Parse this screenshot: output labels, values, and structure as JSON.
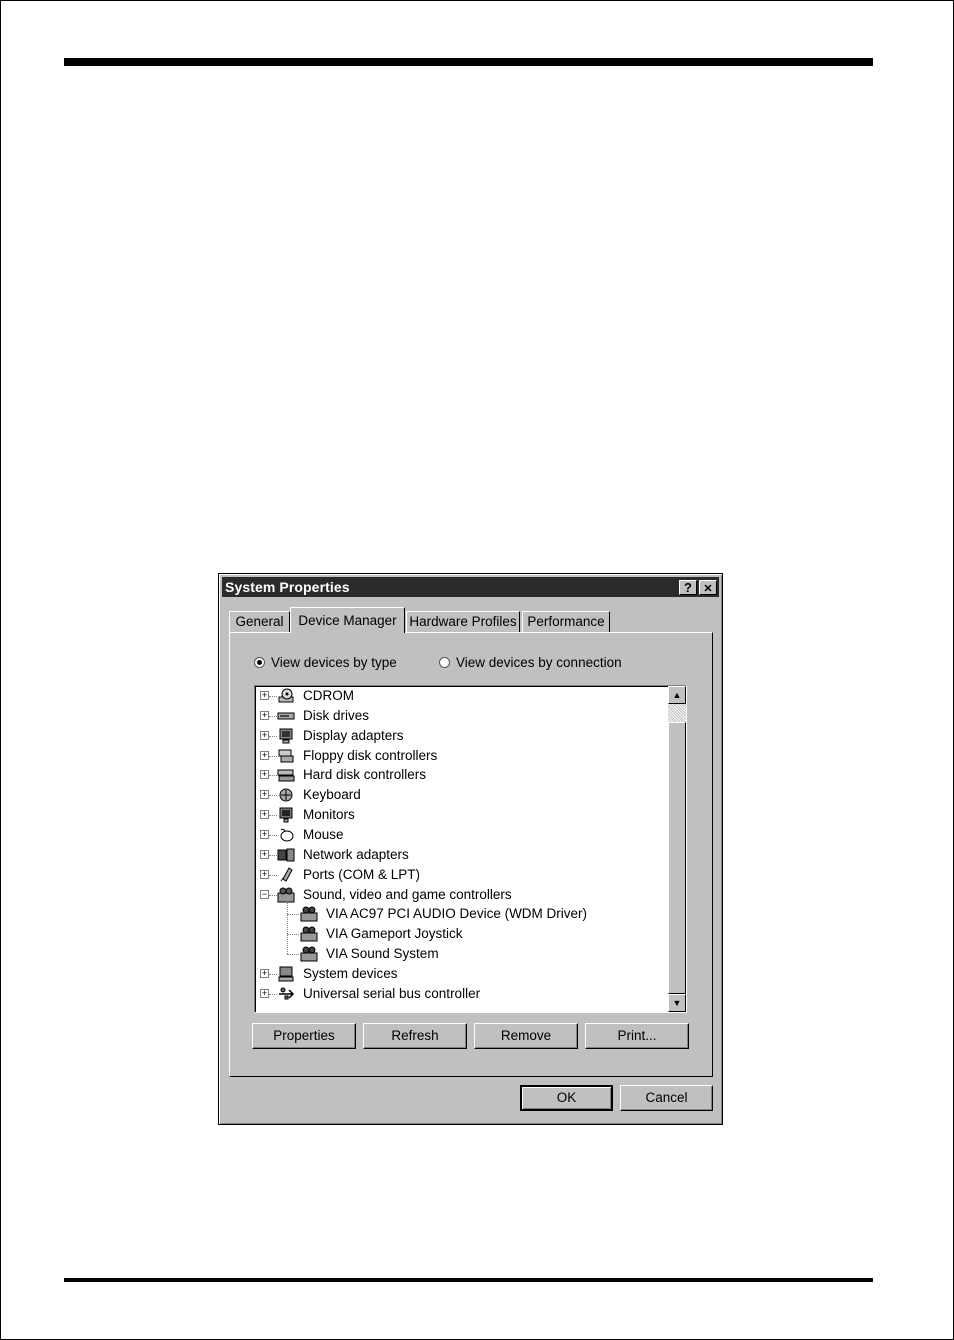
{
  "dialog": {
    "title": "System Properties",
    "help_label": "?",
    "close_label": "✕"
  },
  "tabs": [
    {
      "label": "General"
    },
    {
      "label": "Device Manager"
    },
    {
      "label": "Hardware Profiles"
    },
    {
      "label": "Performance"
    }
  ],
  "active_tab": "Device Manager",
  "view_options": {
    "by_type": {
      "label": "View devices by type",
      "selected": true
    },
    "by_connection": {
      "label": "View devices by connection",
      "selected": false
    }
  },
  "devices": [
    {
      "label": "CDROM",
      "icon": "cdrom-icon",
      "expander": "+"
    },
    {
      "label": "Disk drives",
      "icon": "disk-drive-icon",
      "expander": "+"
    },
    {
      "label": "Display adapters",
      "icon": "display-adapter-icon",
      "expander": "+"
    },
    {
      "label": "Floppy disk controllers",
      "icon": "floppy-controller-icon",
      "expander": "+"
    },
    {
      "label": "Hard disk controllers",
      "icon": "hard-disk-controller-icon",
      "expander": "+"
    },
    {
      "label": "Keyboard",
      "icon": "keyboard-icon",
      "expander": "+"
    },
    {
      "label": "Monitors",
      "icon": "monitor-icon",
      "expander": "+"
    },
    {
      "label": "Mouse",
      "icon": "mouse-icon",
      "expander": "+"
    },
    {
      "label": "Network adapters",
      "icon": "network-adapter-icon",
      "expander": "+"
    },
    {
      "label": "Ports (COM & LPT)",
      "icon": "port-icon",
      "expander": "+"
    },
    {
      "label": "Sound, video and game controllers",
      "icon": "sound-controller-icon",
      "expander": "−",
      "children": [
        {
          "label": "VIA AC97 PCI AUDIO Device (WDM Driver)",
          "icon": "sound-device-icon"
        },
        {
          "label": "VIA Gameport Joystick",
          "icon": "sound-device-icon"
        },
        {
          "label": "VIA Sound System",
          "icon": "sound-device-icon"
        }
      ]
    },
    {
      "label": "System devices",
      "icon": "system-device-icon",
      "expander": "+"
    },
    {
      "label": "Universal serial bus controller",
      "icon": "usb-icon",
      "expander": "+"
    }
  ],
  "action_buttons": {
    "properties": "Properties",
    "refresh": "Refresh",
    "remove": "Remove",
    "print": "Print..."
  },
  "footer_buttons": {
    "ok": "OK",
    "cancel": "Cancel"
  }
}
